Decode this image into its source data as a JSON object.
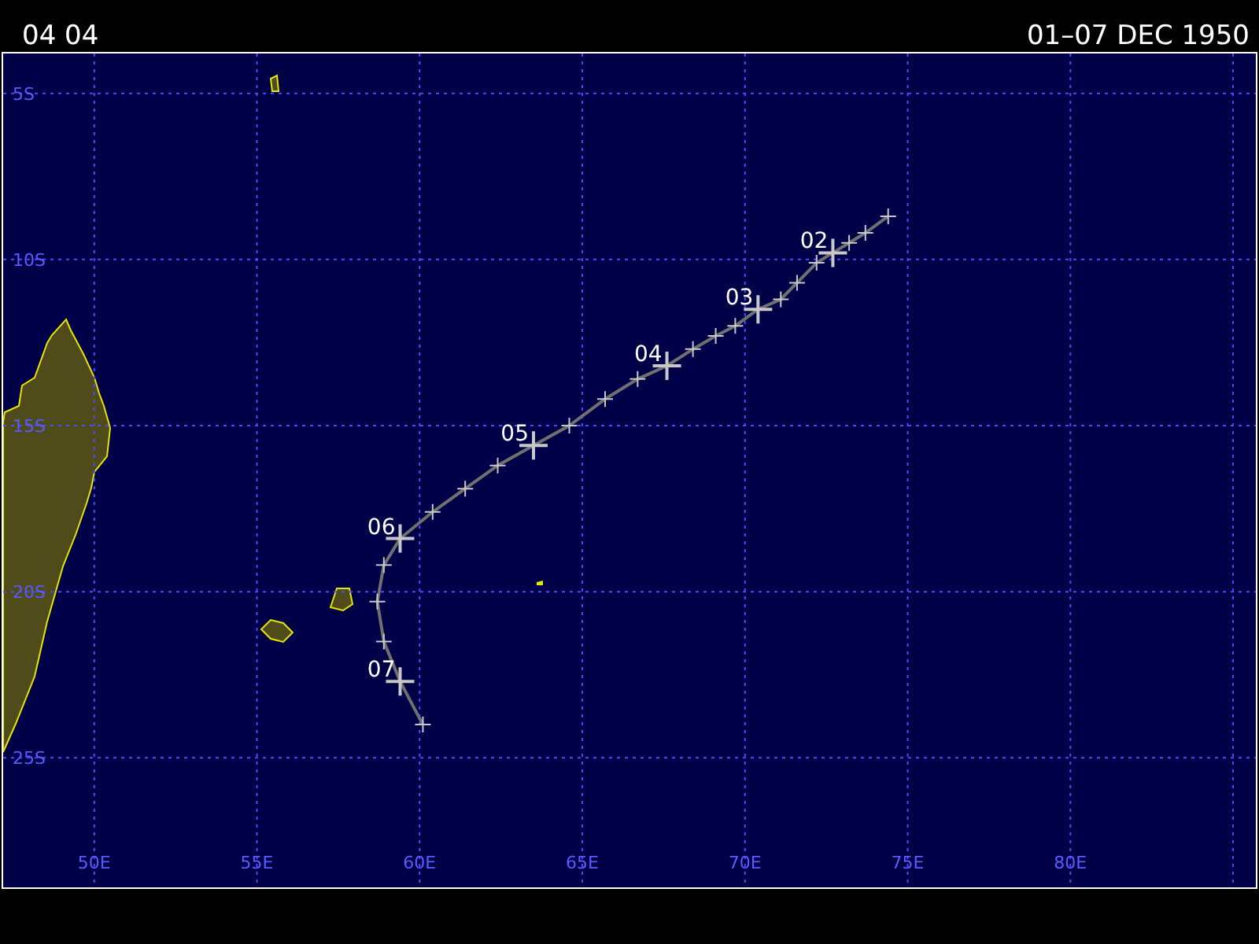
{
  "header": {
    "left": "04 04",
    "right": "01–07 DEC 1950"
  },
  "map": {
    "chart_data": {
      "type": "line",
      "grid": true,
      "xlim": [
        47.2,
        85.7
      ],
      "ylim": [
        -28.9,
        -3.8
      ],
      "xticks": [
        {
          "value": 50,
          "label": "50E"
        },
        {
          "value": 55,
          "label": "55E"
        },
        {
          "value": 60,
          "label": "60E"
        },
        {
          "value": 65,
          "label": "65E"
        },
        {
          "value": 70,
          "label": "70E"
        },
        {
          "value": 75,
          "label": "75E"
        },
        {
          "value": 80,
          "label": "80E"
        }
      ],
      "yticks": [
        {
          "value": -5,
          "label": "5S"
        },
        {
          "value": -10,
          "label": "10S"
        },
        {
          "value": -15,
          "label": "15S"
        },
        {
          "value": -20,
          "label": "20S"
        },
        {
          "value": -25,
          "label": "25S"
        }
      ],
      "x": [
        74.4,
        73.7,
        73.2,
        72.7,
        72.2,
        71.6,
        71.1,
        70.4,
        69.7,
        69.1,
        68.4,
        67.6,
        66.7,
        65.7,
        64.6,
        63.5,
        62.4,
        61.4,
        60.4,
        59.4,
        58.9,
        58.7,
        58.9,
        59.4,
        60.1
      ],
      "series": [
        {
          "color": "#707070",
          "marker": "cross",
          "values": [
            -8.7,
            -9.2,
            -9.5,
            -9.8,
            -10.1,
            -10.7,
            -11.2,
            -11.5,
            -12.0,
            -12.3,
            -12.7,
            -13.2,
            -13.6,
            -14.2,
            -15.0,
            -15.6,
            -16.2,
            -16.9,
            -17.6,
            -18.4,
            -19.2,
            -20.3,
            -21.5,
            -22.7,
            -24.0
          ]
        }
      ],
      "annotations": [
        {
          "x": 72.7,
          "y": -9.8,
          "text": "02"
        },
        {
          "x": 70.4,
          "y": -11.5,
          "text": "03"
        },
        {
          "x": 67.6,
          "y": -13.2,
          "text": "04"
        },
        {
          "x": 63.5,
          "y": -15.6,
          "text": "05"
        },
        {
          "x": 59.4,
          "y": -18.4,
          "text": "06"
        },
        {
          "x": 59.4,
          "y": -22.7,
          "text": "07"
        }
      ]
    }
  }
}
